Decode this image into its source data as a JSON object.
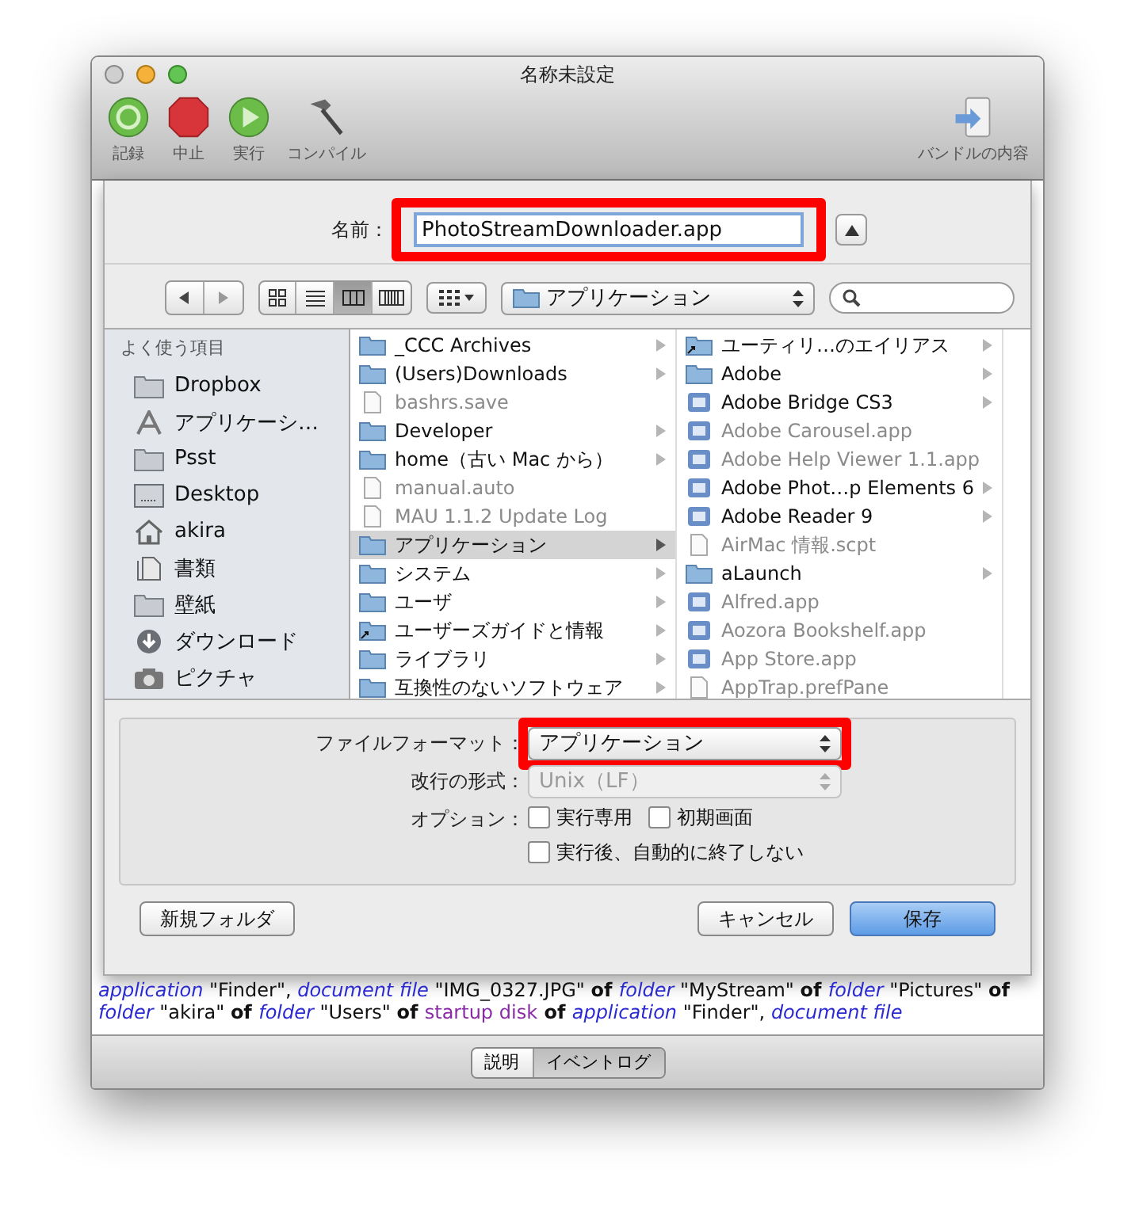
{
  "window": {
    "title": "名称未設定"
  },
  "toolbar": [
    {
      "label": "記録",
      "kind": "record"
    },
    {
      "label": "中止",
      "kind": "stop"
    },
    {
      "label": "実行",
      "kind": "run"
    },
    {
      "label": "コンパイル",
      "kind": "compile"
    }
  ],
  "toolbar_right": {
    "label": "バンドルの内容"
  },
  "save_sheet": {
    "name_label": "名前：",
    "name_value": "PhotoStreamDownloader.app",
    "view_modes": [
      {
        "kind": "icons",
        "selected": false
      },
      {
        "kind": "list",
        "selected": false
      },
      {
        "kind": "columns",
        "selected": true
      },
      {
        "kind": "coverflow",
        "selected": false
      }
    ],
    "location": "アプリケーション",
    "sidebar": {
      "heading": "よく使う項目",
      "items": [
        {
          "label": "Dropbox",
          "kind": "folder"
        },
        {
          "label": "アプリケーシ…",
          "kind": "apps"
        },
        {
          "label": "Psst",
          "kind": "folder"
        },
        {
          "label": "Desktop",
          "kind": "desktop"
        },
        {
          "label": "akira",
          "kind": "home"
        },
        {
          "label": "書類",
          "kind": "documents"
        },
        {
          "label": "壁紙",
          "kind": "folder"
        },
        {
          "label": "ダウンロード",
          "kind": "downloads"
        },
        {
          "label": "ピクチャ",
          "kind": "pictures"
        }
      ]
    },
    "columns": [
      [
        {
          "name": "_CCC Archives",
          "kind": "folder",
          "disabled": false,
          "expandable": true,
          "selected": false
        },
        {
          "name": "(Users)Downloads",
          "kind": "folder",
          "disabled": false,
          "expandable": true,
          "selected": false
        },
        {
          "name": "bashrs.save",
          "kind": "document",
          "disabled": true,
          "expandable": false,
          "selected": false
        },
        {
          "name": "Developer",
          "kind": "folder",
          "disabled": false,
          "expandable": true,
          "selected": false
        },
        {
          "name": "home（古い Mac から）",
          "kind": "folder",
          "disabled": false,
          "expandable": true,
          "selected": false
        },
        {
          "name": "manual.auto",
          "kind": "document",
          "disabled": true,
          "expandable": false,
          "selected": false
        },
        {
          "name": "MAU 1.1.2 Update Log",
          "kind": "document",
          "disabled": true,
          "expandable": false,
          "selected": false
        },
        {
          "name": "アプリケーション",
          "kind": "folder",
          "disabled": false,
          "expandable": true,
          "selected": true
        },
        {
          "name": "システム",
          "kind": "folder",
          "disabled": false,
          "expandable": true,
          "selected": false
        },
        {
          "name": "ユーザ",
          "kind": "folder",
          "disabled": false,
          "expandable": true,
          "selected": false
        },
        {
          "name": "ユーザーズガイドと情報",
          "kind": "alias",
          "disabled": false,
          "expandable": true,
          "selected": false
        },
        {
          "name": "ライブラリ",
          "kind": "folder",
          "disabled": false,
          "expandable": true,
          "selected": false
        },
        {
          "name": "互換性のないソフトウェア",
          "kind": "folder",
          "disabled": false,
          "expandable": true,
          "selected": false
        }
      ],
      [
        {
          "name": "ユーティリ…のエイリアス",
          "kind": "alias",
          "disabled": false,
          "expandable": true,
          "selected": false
        },
        {
          "name": "Adobe",
          "kind": "folder",
          "disabled": false,
          "expandable": true,
          "selected": false
        },
        {
          "name": "Adobe Bridge CS3",
          "kind": "app",
          "disabled": false,
          "expandable": true,
          "selected": false
        },
        {
          "name": "Adobe Carousel.app",
          "kind": "app",
          "disabled": true,
          "expandable": false,
          "selected": false
        },
        {
          "name": "Adobe Help Viewer 1.1.app",
          "kind": "app",
          "disabled": true,
          "expandable": false,
          "selected": false
        },
        {
          "name": "Adobe Phot…p Elements 6",
          "kind": "app",
          "disabled": false,
          "expandable": true,
          "selected": false
        },
        {
          "name": "Adobe Reader 9",
          "kind": "app",
          "disabled": false,
          "expandable": true,
          "selected": false
        },
        {
          "name": "AirMac 情報.scpt",
          "kind": "document",
          "disabled": true,
          "expandable": false,
          "selected": false
        },
        {
          "name": "aLaunch",
          "kind": "folder",
          "disabled": false,
          "expandable": true,
          "selected": false
        },
        {
          "name": "Alfred.app",
          "kind": "app",
          "disabled": true,
          "expandable": false,
          "selected": false
        },
        {
          "name": "Aozora Bookshelf.app",
          "kind": "app",
          "disabled": true,
          "expandable": false,
          "selected": false
        },
        {
          "name": "App Store.app",
          "kind": "app",
          "disabled": true,
          "expandable": false,
          "selected": false
        },
        {
          "name": "AppTrap.prefPane",
          "kind": "document",
          "disabled": true,
          "expandable": false,
          "selected": false
        }
      ]
    ],
    "options": {
      "format_label": "ファイルフォーマット：",
      "format_value": "アプリケーション",
      "newline_label": "改行の形式：",
      "newline_value": "Unix（LF）",
      "newline_disabled": true,
      "options_label": "オプション：",
      "checkboxes": [
        {
          "label": "実行専用",
          "checked": false
        },
        {
          "label": "初期画面",
          "checked": false
        },
        {
          "label": "実行後、自動的に終了しない",
          "checked": false
        }
      ]
    },
    "buttons": [
      {
        "label": "新規フォルダ",
        "kind": "plain"
      },
      {
        "label": "キャンセル",
        "kind": "plain"
      },
      {
        "label": "保存",
        "kind": "default"
      }
    ]
  },
  "script_lines": [
    [
      {
        "text": "application",
        "kind": "class"
      },
      {
        "text": " \"Finder\", ",
        "kind": "literal"
      },
      {
        "text": "document file",
        "kind": "class"
      },
      {
        "text": " \"IMG_0327.JPG\" ",
        "kind": "literal"
      },
      {
        "text": "of ",
        "kind": "keyword"
      },
      {
        "text": "folder",
        "kind": "class"
      },
      {
        "text": " \"MyStream\" ",
        "kind": "literal"
      },
      {
        "text": "of ",
        "kind": "keyword"
      },
      {
        "text": "folder",
        "kind": "class"
      },
      {
        "text": " \"Pictures\" ",
        "kind": "literal"
      },
      {
        "text": "of",
        "kind": "keyword"
      }
    ],
    [
      {
        "text": "folder",
        "kind": "class"
      },
      {
        "text": " \"akira\" ",
        "kind": "literal"
      },
      {
        "text": "of ",
        "kind": "keyword"
      },
      {
        "text": "folder",
        "kind": "class"
      },
      {
        "text": " \"Users\" ",
        "kind": "literal"
      },
      {
        "text": "of ",
        "kind": "keyword"
      },
      {
        "text": "startup disk",
        "kind": "property"
      },
      {
        "text": " of ",
        "kind": "keyword"
      },
      {
        "text": "application",
        "kind": "class"
      },
      {
        "text": " \"Finder\", ",
        "kind": "literal"
      },
      {
        "text": "document file",
        "kind": "class"
      }
    ]
  ],
  "bottom_tabs": [
    {
      "label": "説明",
      "selected": false
    },
    {
      "label": "イベントログ",
      "selected": true
    }
  ]
}
